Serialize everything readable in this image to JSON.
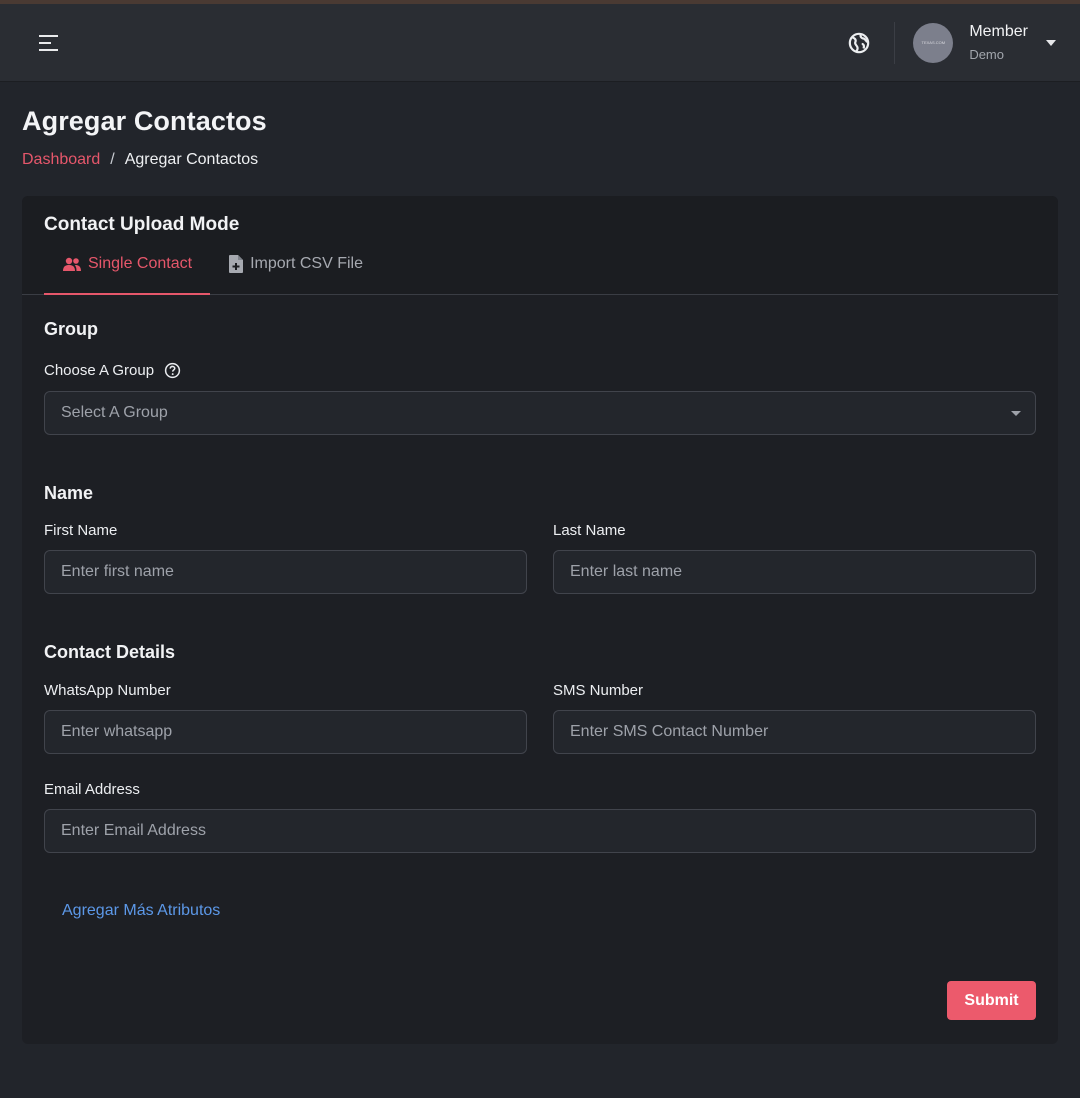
{
  "header": {
    "user_name": "Member",
    "user_role": "Demo",
    "avatar_text": "TEXAS.COM"
  },
  "page": {
    "title": "Agregar Contactos",
    "breadcrumb": {
      "link": "Dashboard",
      "separator": "/",
      "current": "Agregar Contactos"
    }
  },
  "card": {
    "title": "Contact Upload Mode",
    "tabs": [
      {
        "label": "Single Contact",
        "icon": "users-icon",
        "active": true
      },
      {
        "label": "Import CSV File",
        "icon": "file-plus-icon",
        "active": false
      }
    ]
  },
  "form": {
    "group": {
      "section": "Group",
      "label": "Choose A Group",
      "placeholder": "Select A Group"
    },
    "name": {
      "section": "Name",
      "first_label": "First Name",
      "first_placeholder": "Enter first name",
      "last_label": "Last Name",
      "last_placeholder": "Enter last name"
    },
    "contact": {
      "section": "Contact Details",
      "whatsapp_label": "WhatsApp Number",
      "whatsapp_placeholder": "Enter whatsapp",
      "sms_label": "SMS Number",
      "sms_placeholder": "Enter SMS Contact Number",
      "email_label": "Email Address",
      "email_placeholder": "Enter Email Address"
    },
    "add_more": "Agregar Más Atributos",
    "submit": "Submit"
  },
  "colors": {
    "accent": "#e6576b",
    "link": "#5c98e8",
    "submit_bg": "#ec5a6c"
  }
}
